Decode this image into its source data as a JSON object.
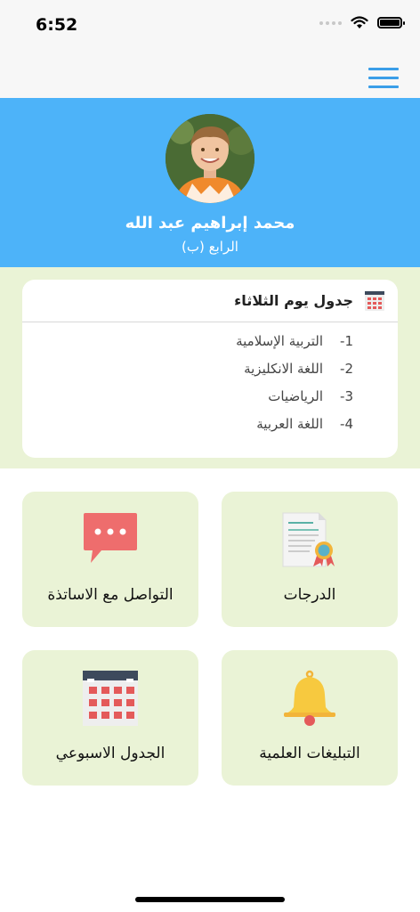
{
  "status": {
    "time": "6:52"
  },
  "profile": {
    "name": "محمد إبراهيم عبد الله",
    "class": "الرابع (ب)"
  },
  "schedule": {
    "title": "جدول يوم الثلاثاء",
    "lessons": [
      {
        "num": "1-",
        "subject": "التربية الإسلامية"
      },
      {
        "num": "2-",
        "subject": "اللغة الانكليزية"
      },
      {
        "num": "3-",
        "subject": "الرياضيات"
      },
      {
        "num": "4-",
        "subject": "اللغة العربية"
      }
    ]
  },
  "tiles": {
    "grades": {
      "label": "الدرجات",
      "icon": "certificate-icon"
    },
    "teachers": {
      "label": "التواصل مع الاساتذة",
      "icon": "chat-bubble-icon"
    },
    "notifications": {
      "label": "التبليغات العلمية",
      "icon": "bell-icon"
    },
    "weekly": {
      "label": "الجدول الاسبوعي",
      "icon": "calendar-icon"
    }
  },
  "colors": {
    "header_blue": "#4db3f9",
    "tile_green": "#eaf3d6",
    "menu_blue": "#3a9ee8"
  }
}
